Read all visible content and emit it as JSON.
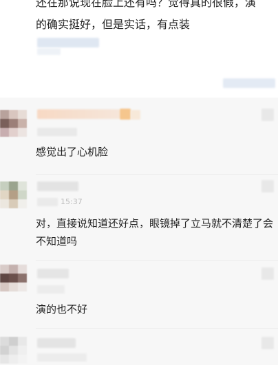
{
  "post": {
    "lines": [
      "还在那说现在脸上还有吗？觉得真的很假，演",
      "的确实挺好，但是实话，有点装"
    ]
  },
  "comments": [
    {
      "text": "感觉出了心机脸"
    },
    {
      "time": "15:37",
      "text": "对，直接说知道还好点，眼镜掉了立马就不清楚了会\n不知道吗"
    },
    {
      "text": "演的也不好"
    }
  ]
}
